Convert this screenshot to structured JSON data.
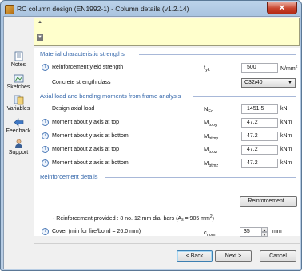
{
  "window": {
    "title": "RC column design (EN1992-1) - Column details (v1.2.14)",
    "close_glyph": "✕"
  },
  "sidebar": {
    "items": [
      {
        "label": "Notes",
        "icon": "notes-icon"
      },
      {
        "label": "Sketches",
        "icon": "sketches-icon"
      },
      {
        "label": "Variables",
        "icon": "variables-icon"
      },
      {
        "label": "Feedback",
        "icon": "feedback-icon"
      },
      {
        "label": "Support",
        "icon": "support-icon"
      }
    ]
  },
  "banner": {
    "scroll_up": "▲",
    "scroll_down": "▼"
  },
  "sections": {
    "material": "Material characteristic strengths",
    "axial": "Axial load and bending moments from frame analysis",
    "reinforcement": "Reinforcement details"
  },
  "rows": {
    "fyk": {
      "label": "Reinforcement yield strength",
      "symbol_main": "f",
      "symbol_sub": "yk",
      "value": "500",
      "unit_main": "N/mm",
      "unit_sup": "2"
    },
    "concrete": {
      "label": "Concrete strength class",
      "value": "C32/40",
      "arrow": "▼"
    },
    "ned": {
      "label": "Design axial load",
      "symbol_main": "N",
      "symbol_sub": "Ed",
      "value": "1451.5",
      "unit": "kN"
    },
    "my_top": {
      "label": "Moment about y axis at top",
      "symbol_main": "M",
      "symbol_sub": "topy",
      "value": "47.2",
      "unit": "kNm"
    },
    "my_btm": {
      "label": "Moment about y axis at bottom",
      "symbol_main": "M",
      "symbol_sub": "btmy",
      "value": "47.2",
      "unit": "kNm"
    },
    "mz_top": {
      "label": "Moment about z axis at top",
      "symbol_main": "M",
      "symbol_sub": "topz",
      "value": "47.2",
      "unit": "kNm"
    },
    "mz_btm": {
      "label": "Moment about z axis at bottom",
      "symbol_main": "M",
      "symbol_sub": "btmz",
      "value": "47.2",
      "unit": "kNm"
    },
    "cover": {
      "label": "Cover (min for fire/bond = 26.0 mm)",
      "symbol_main": "c",
      "symbol_sub": "nom",
      "value": "35",
      "unit": "mm",
      "up": "▲",
      "down": "▼"
    }
  },
  "reinforcement": {
    "button_label": "Reinforcement...",
    "note_prefix": "- Reinforcement provided : 8 no. 12 mm dia. bars (A",
    "note_sub": "s",
    "note_mid": " = 905 mm",
    "note_sup": "2",
    "note_end": ")"
  },
  "info_glyph": "i",
  "footer": {
    "back": "< Back",
    "next": "Next >",
    "cancel": "Cancel"
  }
}
